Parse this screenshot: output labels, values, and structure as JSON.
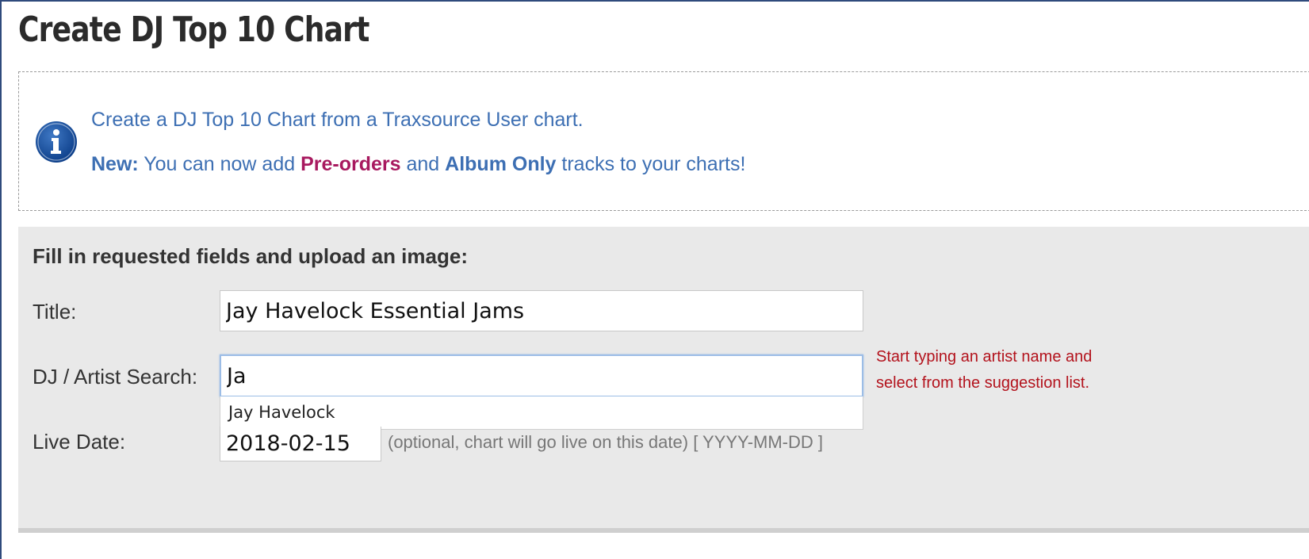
{
  "page": {
    "title": "Create DJ Top 10 Chart"
  },
  "info": {
    "line1": "Create a DJ Top 10 Chart from a Traxsource User chart.",
    "new_label": "New:",
    "line2_part1": " You can now add ",
    "preorders": "Pre-orders",
    "line2_part2": " and ",
    "album_only": "Album Only",
    "line2_part3": " tracks to your charts!",
    "icon": "info-icon"
  },
  "form": {
    "heading": "Fill in requested fields and upload an image:",
    "title_label": "Title:",
    "title_value": "Jay Havelock Essential Jams",
    "artist_label": "DJ / Artist Search:",
    "artist_value": "Ja",
    "artist_hint": "Start typing an artist name and select from the suggestion list.",
    "suggestions": [
      "Jay Havelock"
    ],
    "date_label": "Live Date:",
    "date_value": "2018-02-15",
    "date_help": "(optional, chart will go live on this date) [ YYYY-MM-DD ]"
  },
  "colors": {
    "link_blue": "#3d6fb3",
    "magenta": "#a8195f",
    "hint_red": "#b3121c",
    "panel_bg": "#e9e9e9"
  }
}
